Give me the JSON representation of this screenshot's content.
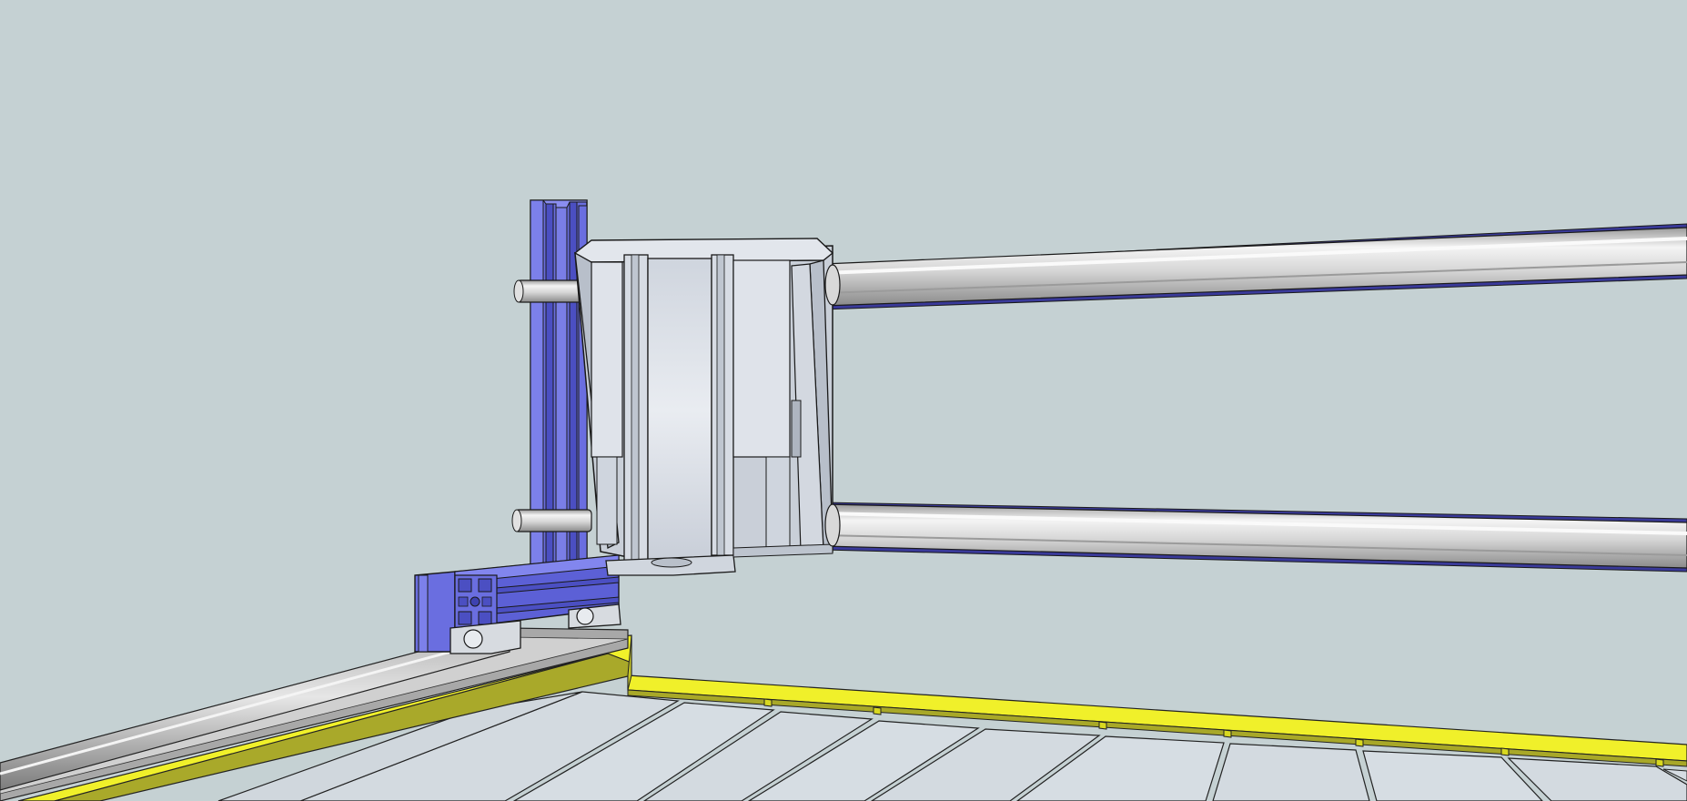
{
  "scene": {
    "background_color": "#c5d1d3",
    "colors": {
      "aluminum_extrusion": "#6a6ee0",
      "aluminum_extrusion_dark": "#4b4fc2",
      "rod_light": "#f2f2f2",
      "rod_mid": "#c9c9c9",
      "rod_dark": "#8c8c8c",
      "bracket_face": "#dde2ea",
      "bracket_shade": "#bcc3ce",
      "table_frame_yellow": "#f0f02a",
      "table_frame_olive": "#a9a92a",
      "table_slat": "#d5dce2",
      "outline": "#1a1a1a"
    }
  }
}
